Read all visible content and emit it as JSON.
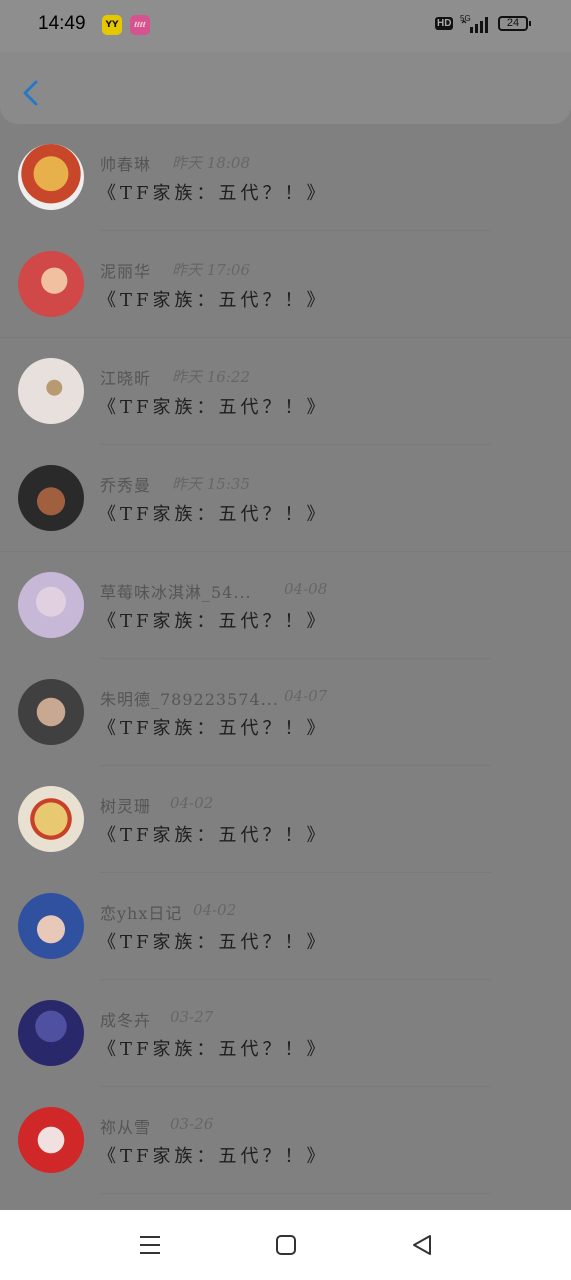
{
  "status_bar": {
    "time": "14:49",
    "app_badges": [
      {
        "name": "yy-app",
        "label": "YY",
        "color": "#e6c800"
      },
      {
        "name": "pink-app",
        "label": "ℓℓℓℓ",
        "color": "#d6538f"
      }
    ],
    "hd_label": "HD",
    "network": "5G",
    "battery": "24"
  },
  "header": {
    "back_icon": "chevron-left-icon",
    "accent_color": "#2878c8"
  },
  "comments": [
    {
      "name": "帅春琳",
      "time": "昨天 18:08",
      "message": "《TF家族：五代？！》",
      "avatar_colors": [
        "#c8462a",
        "#e8b04a"
      ]
    },
    {
      "name": "泥丽华",
      "time": "昨天 17:06",
      "message": "《TF家族：五代？！》",
      "avatar_colors": [
        "#d04848",
        "#f0c0a0"
      ]
    },
    {
      "name": "江晓昕",
      "time": "昨天 16:22",
      "message": "《TF家族：五代？！》",
      "avatar_colors": [
        "#e8e0dc",
        "#b89a72"
      ]
    },
    {
      "name": "乔秀曼",
      "time": "昨天 15:35",
      "message": "《TF家族：五代？！》",
      "avatar_colors": [
        "#2a2a2a",
        "#a06040"
      ]
    },
    {
      "name": "草莓味冰淇淋_54...",
      "time": "04-08",
      "message": "《TF家族：五代？！》",
      "avatar_colors": [
        "#c8b8d8",
        "#e0d0e0"
      ]
    },
    {
      "name": "朱明德_789223574...",
      "time": "04-07",
      "message": "《TF家族：五代？！》",
      "avatar_colors": [
        "#404040",
        "#c8a890"
      ]
    },
    {
      "name": "树灵珊",
      "time": "04-02",
      "message": "《TF家族：五代？！》",
      "avatar_colors": [
        "#e8c870",
        "#c84028"
      ]
    },
    {
      "name": "恋yhx日记",
      "time": "04-02",
      "message": "《TF家族：五代？！》",
      "avatar_colors": [
        "#3050a0",
        "#e8c8b8"
      ]
    },
    {
      "name": "成冬卉",
      "time": "03-27",
      "message": "《TF家族：五代？！》",
      "avatar_colors": [
        "#28286a",
        "#5050a0"
      ]
    },
    {
      "name": "祢从雪",
      "time": "03-26",
      "message": "《TF家族：五代？！》",
      "avatar_colors": [
        "#d02828",
        "#f0e0e0"
      ]
    }
  ],
  "nav_bar": {
    "menu_icon": "menu-icon",
    "home_icon": "home-icon",
    "back_icon": "triangle-back-icon"
  }
}
